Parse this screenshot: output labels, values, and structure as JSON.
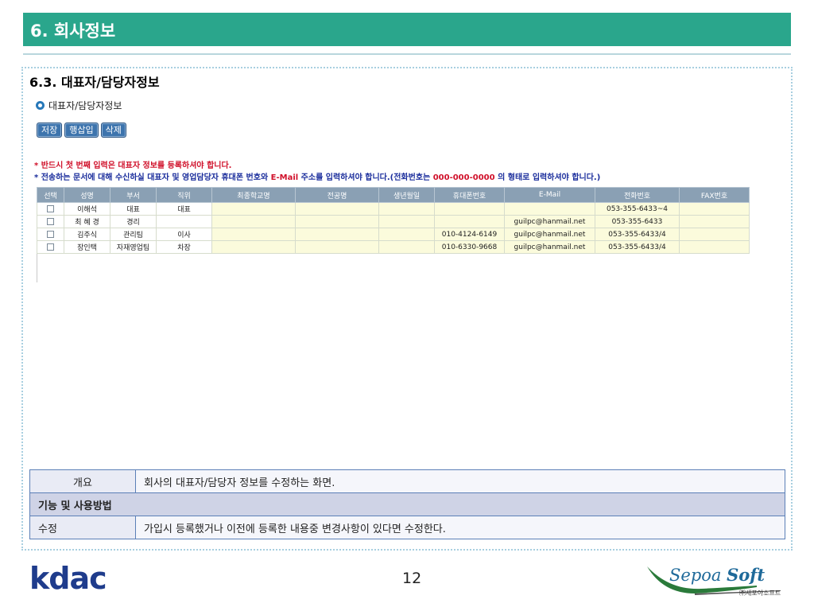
{
  "header": {
    "title": "6. 회사정보"
  },
  "section": {
    "title": "6.3. 대표자/담당자정보"
  },
  "panel": {
    "subtitle": "대표자/담당자정보"
  },
  "toolbar": {
    "save_label": "저장",
    "insert_row_label": "행삽입",
    "delete_label": "삭제"
  },
  "notices": {
    "line1": "* 반드시 첫 번째 입력은 대표자 정보를 등록하셔야 합니다.",
    "line2_a": "* 전송하는 문서에 대해 수신하실 대표자 및 영업담당자 휴대폰 번호와 ",
    "line2_b": "E-Mail",
    "line2_c": " 주소를 입력하셔야 합니다.(전화번호는 ",
    "line2_d": "000-000-0000",
    "line2_e": " 의 형태로 입력하셔야 합니다.)"
  },
  "grid": {
    "columns": [
      "선택",
      "성명",
      "부서",
      "직위",
      "최종학교명",
      "전공명",
      "생년월일",
      "휴대폰번호",
      "E-Mail",
      "전화번호",
      "FAX번호"
    ],
    "rows": [
      {
        "name": "이해석",
        "dept": "대표",
        "position": "대표",
        "school": "",
        "major": "",
        "birth": "",
        "mobile": "",
        "email": "",
        "phone": "053-355-6433~4",
        "fax": ""
      },
      {
        "name": "최 혜 경",
        "dept": "경리",
        "position": "",
        "school": "",
        "major": "",
        "birth": "",
        "mobile": "",
        "email": "guilpc@hanmail.net",
        "phone": "053-355-6433",
        "fax": ""
      },
      {
        "name": "김주식",
        "dept": "관리팀",
        "position": "이사",
        "school": "",
        "major": "",
        "birth": "",
        "mobile": "010-4124-6149",
        "email": "guilpc@hanmail.net",
        "phone": "053-355-6433/4",
        "fax": ""
      },
      {
        "name": "장인택",
        "dept": "자재영업팀",
        "position": "차장",
        "school": "",
        "major": "",
        "birth": "",
        "mobile": "010-6330-9668",
        "email": "guilpc@hanmail.net",
        "phone": "053-355-6433/4",
        "fax": ""
      }
    ]
  },
  "info": {
    "overview_label": "개요",
    "overview_text": "회사의 대표자/담당자 정보를 수정하는 화면.",
    "function_header": "기능 및 사용방법",
    "edit_label": "수정",
    "edit_text": "가입시 등록했거나 이전에 등록한 내용중 변경사항이 있다면 수정한다."
  },
  "footer": {
    "left_logo": "kdac",
    "page_number": "12",
    "right_logo_a": "Sepoa",
    "right_logo_b": "Soft",
    "right_logo_sub": "㈜세포아소프트"
  },
  "colors": {
    "header": "#2aa68c",
    "grid_header": "#8aa0b4",
    "editable_cell": "#fbfbdc",
    "button": "#3d74ad"
  }
}
